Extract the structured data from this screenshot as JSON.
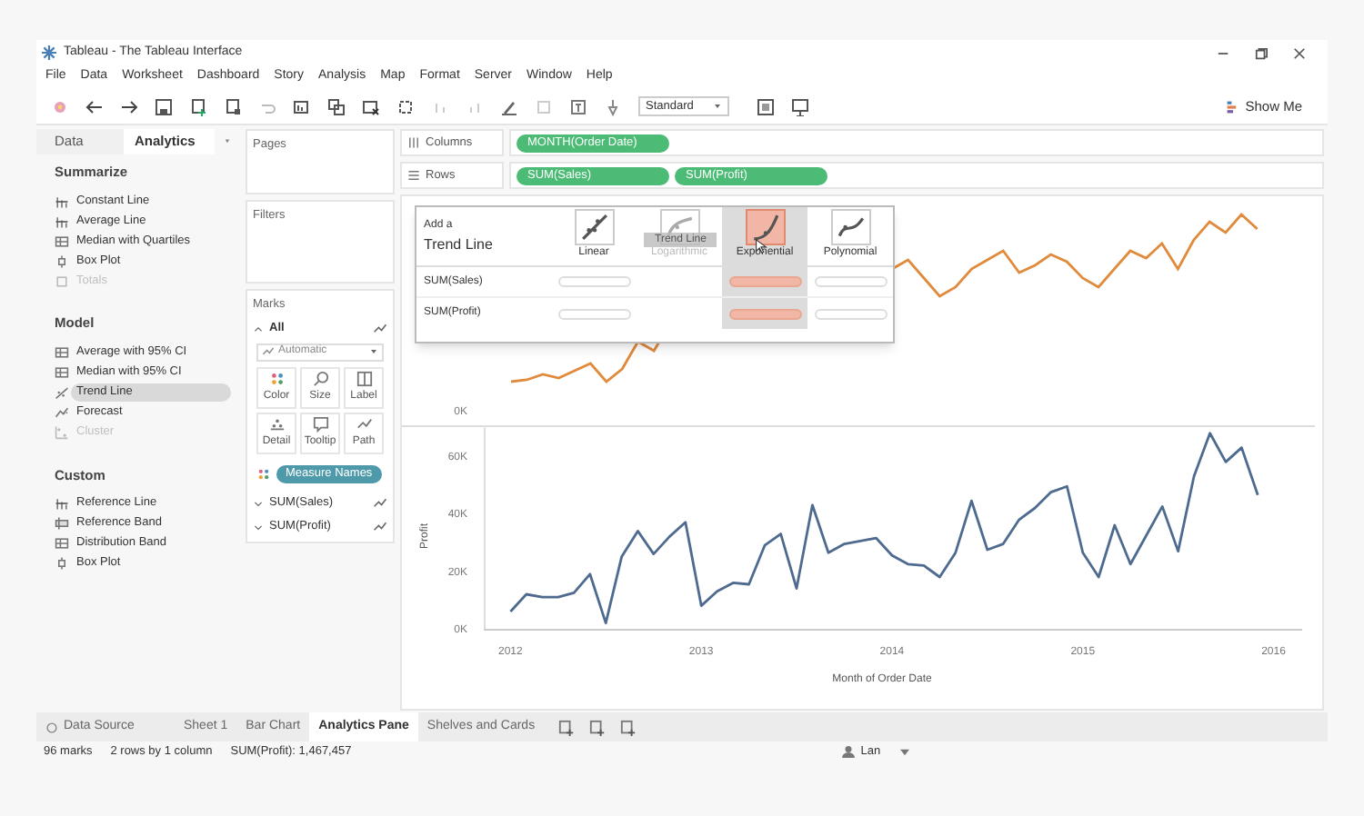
{
  "window": {
    "title": "Tableau - The Tableau Interface"
  },
  "menu": [
    "File",
    "Data",
    "Worksheet",
    "Dashboard",
    "Story",
    "Analysis",
    "Map",
    "Format",
    "Server",
    "Window",
    "Help"
  ],
  "toolbar": {
    "fit": "Standard",
    "show_me": "Show Me"
  },
  "side_tabs": [
    {
      "label": "Data",
      "selected": false
    },
    {
      "label": "Analytics",
      "selected": true
    }
  ],
  "analytics": [
    {
      "title": "Summarize",
      "items": [
        {
          "label": "Constant Line",
          "kind": "line",
          "disabled": false,
          "selected": false
        },
        {
          "label": "Average Line",
          "kind": "line",
          "disabled": false,
          "selected": false
        },
        {
          "label": "Median with Quartiles",
          "kind": "band",
          "disabled": false,
          "selected": false
        },
        {
          "label": "Box Plot",
          "kind": "box",
          "disabled": false,
          "selected": false
        },
        {
          "label": "Totals",
          "kind": "total",
          "disabled": true,
          "selected": false
        }
      ]
    },
    {
      "title": "Model",
      "items": [
        {
          "label": "Average with 95% CI",
          "kind": "band",
          "disabled": false,
          "selected": false
        },
        {
          "label": "Median with 95% CI",
          "kind": "band",
          "disabled": false,
          "selected": false
        },
        {
          "label": "Trend Line",
          "kind": "trend",
          "disabled": false,
          "selected": true
        },
        {
          "label": "Forecast",
          "kind": "forecast",
          "disabled": false,
          "selected": false
        },
        {
          "label": "Cluster",
          "kind": "cluster",
          "disabled": true,
          "selected": false
        }
      ]
    },
    {
      "title": "Custom",
      "items": [
        {
          "label": "Reference Line",
          "kind": "line",
          "disabled": false,
          "selected": false
        },
        {
          "label": "Reference Band",
          "kind": "refband",
          "disabled": false,
          "selected": false
        },
        {
          "label": "Distribution Band",
          "kind": "band",
          "disabled": false,
          "selected": false
        },
        {
          "label": "Box Plot",
          "kind": "box",
          "disabled": false,
          "selected": false
        }
      ]
    }
  ],
  "cards": {
    "pages": "Pages",
    "filters": "Filters",
    "marks": {
      "title": "Marks",
      "groups": [
        {
          "label": "All",
          "expanded": true
        },
        {
          "label": "SUM(Sales)",
          "expanded": false
        },
        {
          "label": "SUM(Profit)",
          "expanded": false
        }
      ],
      "mark_type": "Automatic",
      "buttons": [
        "Color",
        "Size",
        "Label",
        "Detail",
        "Tooltip",
        "Path"
      ],
      "pill": "Measure Names"
    }
  },
  "shelves": [
    {
      "label": "Columns",
      "pills": [
        "MONTH(Order Date)"
      ]
    },
    {
      "label": "Rows",
      "pills": [
        "SUM(Sales)",
        "SUM(Profit)"
      ]
    }
  ],
  "trend_popup": {
    "title_1": "Add a",
    "title_2": "Trend Line",
    "options": [
      {
        "label": "Linear",
        "selected": false,
        "disabled": false
      },
      {
        "label": "Logarithmic",
        "selected": false,
        "disabled": true
      },
      {
        "label": "Exponential",
        "selected": true,
        "disabled": false
      },
      {
        "label": "Polynomial",
        "selected": false,
        "disabled": false
      }
    ],
    "rows": [
      "SUM(Sales)",
      "SUM(Profit)"
    ],
    "drag_ghost": "Trend Line"
  },
  "sales_pane": {
    "tick": "0K"
  },
  "profit_pane": {
    "chart_data": {
      "type": "line",
      "xlabel": "Month of Order Date",
      "ylabel": "Profit",
      "x": [
        2012,
        2012.083,
        2012.167,
        2012.25,
        2012.333,
        2012.417,
        2012.5,
        2012.583,
        2012.667,
        2012.75,
        2012.833,
        2012.917,
        2013,
        2013.083,
        2013.167,
        2013.25,
        2013.333,
        2013.417,
        2013.5,
        2013.583,
        2013.667,
        2013.75,
        2013.833,
        2013.917,
        2014,
        2014.083,
        2014.167,
        2014.25,
        2014.333,
        2014.417,
        2014.5,
        2014.583,
        2014.667,
        2014.75,
        2014.833,
        2014.917,
        2015,
        2015.083,
        2015.167,
        2015.25,
        2015.333,
        2015.417,
        2015.5,
        2015.583,
        2015.667,
        2015.75,
        2015.833,
        2015.917
      ],
      "xlim": [
        2011.86,
        2016.15
      ],
      "ylim": [
        0,
        70
      ],
      "xticks": [
        2012,
        2013,
        2014,
        2015,
        2016
      ],
      "yticks": [
        {
          "value": 0,
          "label": "0K"
        },
        {
          "value": 20,
          "label": "20K"
        },
        {
          "value": 40,
          "label": "40K"
        },
        {
          "value": 60,
          "label": "60K"
        }
      ],
      "series": [
        {
          "color": "#4e6b8f",
          "values": [
            6,
            12,
            11,
            11,
            12.5,
            19,
            2,
            25,
            34,
            26,
            32,
            37,
            8,
            13,
            16,
            15.5,
            29,
            33,
            14,
            43,
            26.5,
            29.5,
            30.5,
            31.5,
            25.5,
            22.5,
            22,
            18,
            26.5,
            44.5,
            27.5,
            29.5,
            38,
            42,
            47.5,
            49.5,
            26.5,
            18,
            36,
            22.5,
            32.5,
            42.5,
            27,
            53,
            68,
            58,
            63,
            46.5
          ]
        }
      ]
    }
  },
  "sheet_tabs": [
    {
      "label": "Data Source",
      "kind": "source",
      "selected": false
    },
    {
      "label": "Sheet 1",
      "kind": "sheet",
      "selected": false
    },
    {
      "label": "Bar Chart",
      "kind": "sheet",
      "selected": false
    },
    {
      "label": "Analytics Pane",
      "kind": "sheet",
      "selected": true
    },
    {
      "label": "Shelves and Cards",
      "kind": "sheet",
      "selected": false
    }
  ],
  "status_bar": {
    "marks": "96 marks",
    "dims": "2 rows by 1 column",
    "sum": "SUM(Profit): 1,467,457",
    "user": "Lan"
  }
}
